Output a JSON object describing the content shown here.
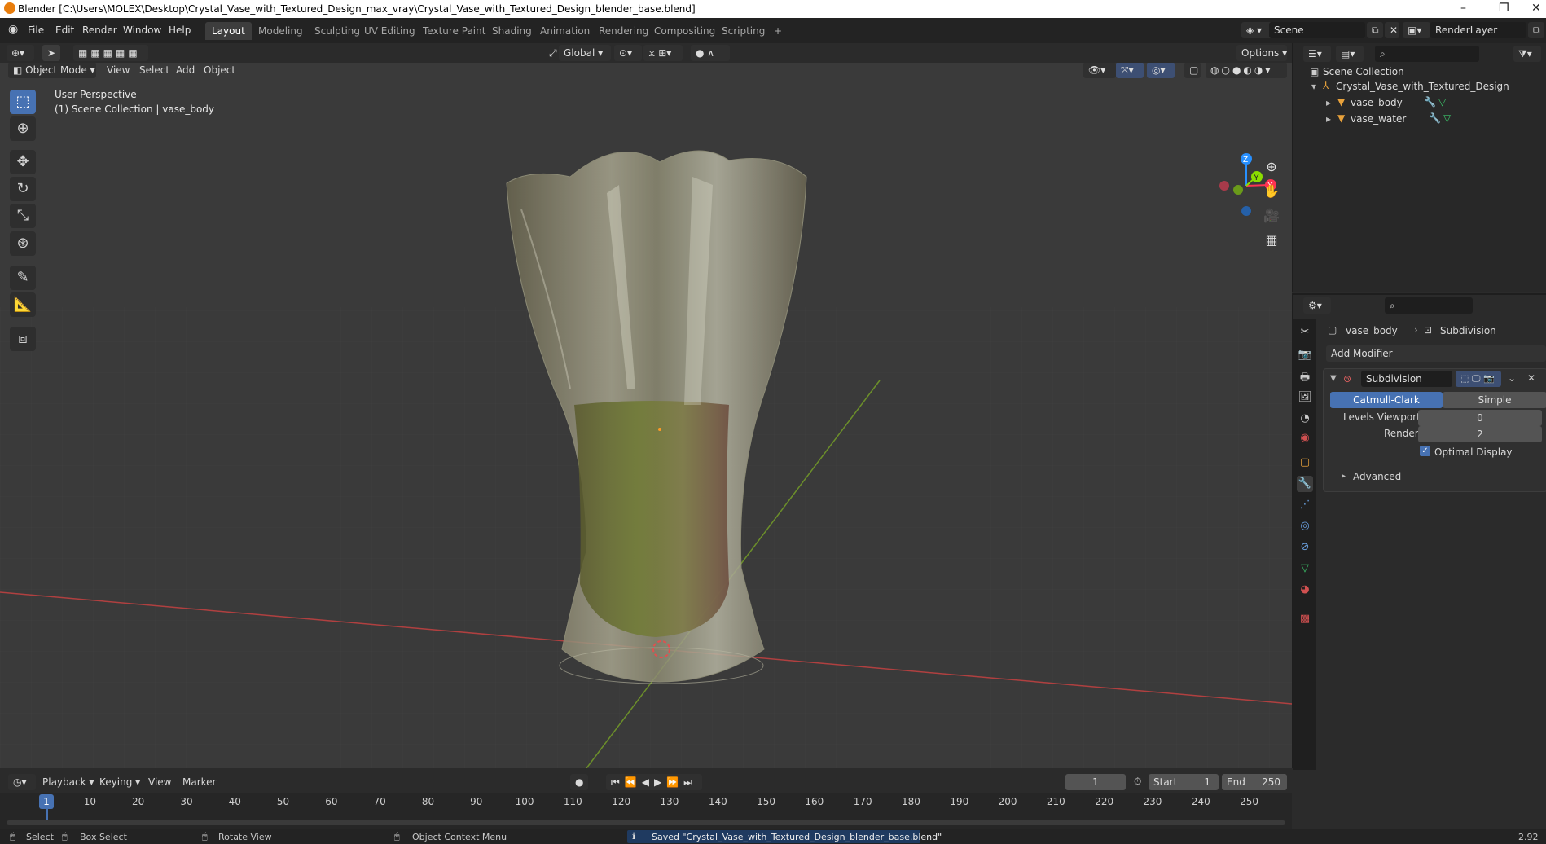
{
  "window": {
    "title": "Blender [C:\\Users\\MOLEX\\Desktop\\Crystal_Vase_with_Textured_Design_max_vray\\Crystal_Vase_with_Textured_Design_blender_base.blend]",
    "controls": [
      "–",
      "❐",
      "✕"
    ]
  },
  "menu": {
    "items": [
      "File",
      "Edit",
      "Render",
      "Window",
      "Help"
    ],
    "workspaces": [
      "Layout",
      "Modeling",
      "Sculpting",
      "UV Editing",
      "Texture Paint",
      "Shading",
      "Animation",
      "Rendering",
      "Compositing",
      "Scripting"
    ],
    "active_workspace": "Layout",
    "add_tab": "+",
    "scene": "Scene",
    "render_layer": "RenderLayer"
  },
  "viewport_header": {
    "mode": "Object Mode",
    "menus": [
      "View",
      "Select",
      "Add",
      "Object"
    ],
    "transform": "Global",
    "options": "Options"
  },
  "viewport": {
    "perspective": "User Perspective",
    "collection_info": "(1) Scene Collection | vase_body",
    "gizmo_axes": [
      "Z",
      "Y",
      "X"
    ],
    "colors": {
      "x_axis": "#ff3352",
      "y_axis": "#8bdc00",
      "z_axis": "#2890ff"
    }
  },
  "outliner": {
    "root": "Scene Collection",
    "collection": "Crystal_Vase_with_Textured_Design",
    "objects": [
      "vase_body",
      "vase_water"
    ]
  },
  "properties": {
    "object": "vase_body",
    "modifier_breadcrumb": "Subdivision",
    "add_modifier": "Add Modifier",
    "modifier_name": "Subdivision",
    "type_options": [
      "Catmull-Clark",
      "Simple"
    ],
    "active_type": "Catmull-Clark",
    "levels_viewport_label": "Levels Viewport",
    "levels_viewport_value": "0",
    "render_label": "Render",
    "render_value": "2",
    "optimal_display_label": "Optimal Display",
    "optimal_display_checked": true,
    "advanced": "Advanced"
  },
  "timeline": {
    "menus": [
      "Playback",
      "Keying",
      "View",
      "Marker"
    ],
    "current_frame": "1",
    "start_label": "Start",
    "start_value": "1",
    "end_label": "End",
    "end_value": "250",
    "frame_marks": [
      "10",
      "20",
      "30",
      "40",
      "50",
      "60",
      "70",
      "80",
      "90",
      "100",
      "110",
      "120",
      "130",
      "140",
      "150",
      "160",
      "170",
      "180",
      "190",
      "200",
      "210",
      "220",
      "230",
      "240",
      "250"
    ],
    "playhead": "1"
  },
  "statusbar": {
    "select": "Select",
    "box_select": "Box Select",
    "rotate_view": "Rotate View",
    "context_menu": "Object Context Menu",
    "message": "Saved \"Crystal_Vase_with_Textured_Design_blender_base.blend\"",
    "version": "2.92"
  }
}
